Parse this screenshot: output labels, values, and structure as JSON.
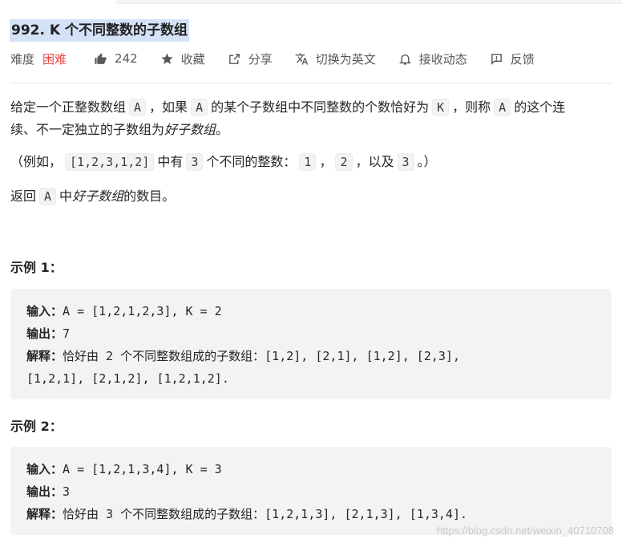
{
  "problem": {
    "title": "992. K 个不同整数的子数组"
  },
  "meta": {
    "difficulty_label": "难度",
    "difficulty": "困难",
    "likes": "242",
    "favorite": "收藏",
    "share": "分享",
    "switch_lang": "切换为英文",
    "subscribe": "接收动态",
    "feedback": "反馈",
    "colors": {
      "difficulty": "#ef4743",
      "highlight": "#d4e2f7"
    }
  },
  "description": {
    "p1": {
      "t1": "给定一个正整数数组",
      "c1": "A",
      "t2": "，如果",
      "c2": "A",
      "t3": "的某个子数组中不同整数的个数恰好为",
      "c3": "K",
      "t4": "，则称",
      "c4": "A",
      "t5": "的这个连",
      "t6": "续、不一定独立的子数组为",
      "em": "好子数组",
      "t7": "。"
    },
    "p2": {
      "t1": "（例如，",
      "c1": "[1,2,3,1,2]",
      "t2": "中有",
      "c2": "3",
      "t3": "个不同的整数：",
      "c3": "1",
      "t4": "，",
      "c4": "2",
      "t5": "，以及",
      "c5": "3",
      "t6": "。）"
    },
    "p3": {
      "t1": "返回",
      "c1": "A",
      "t2": "中",
      "em": "好子数组",
      "t3": "的数目。"
    }
  },
  "examples": [
    {
      "heading": "示例 1：",
      "input_label": "输入：",
      "input": "A = [1,2,1,2,3], K = 2",
      "output_label": "输出：",
      "output": "7",
      "explain_label": "解释：",
      "explain_text1": "恰好由",
      "explain_num": " 2 ",
      "explain_text2": "个不同整数组成的子数组：",
      "explain_code1": "[1,2], [2,1], [1,2], [2,3],",
      "explain_code2": "[1,2,1], [2,1,2], [1,2,1,2]."
    },
    {
      "heading": "示例 2：",
      "input_label": "输入：",
      "input": "A = [1,2,1,3,4], K = 3",
      "output_label": "输出：",
      "output": "3",
      "explain_label": "解释：",
      "explain_text1": "恰好由",
      "explain_num": " 3 ",
      "explain_text2": "个不同整数组成的子数组：",
      "explain_code1": "[1,2,1,3], [2,1,3], [1,3,4]."
    }
  ],
  "watermark": "https://blog.csdn.net/weixin_40710708"
}
